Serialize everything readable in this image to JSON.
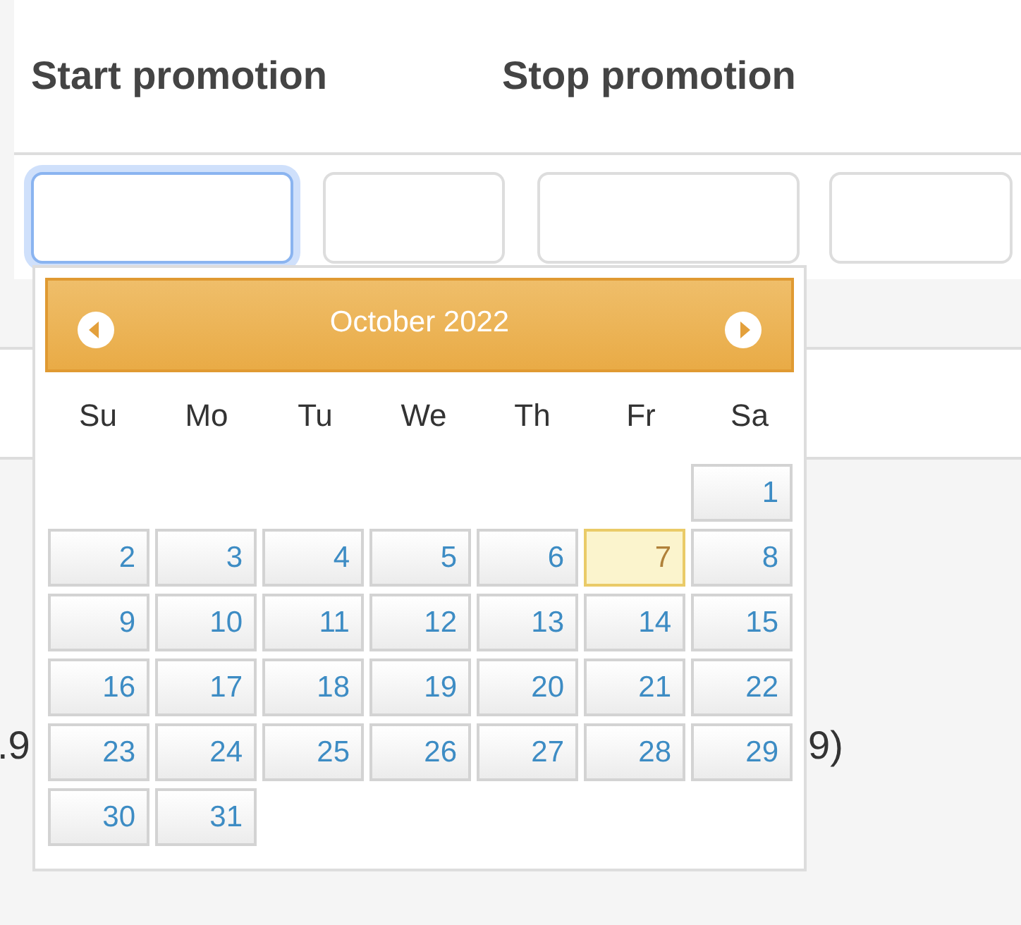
{
  "headings": [
    "Start promotion",
    "Stop promotion"
  ],
  "fields": [
    {
      "focused": true
    },
    {
      "focused": false
    },
    {
      "focused": false
    },
    {
      "focused": false
    }
  ],
  "background_texts": [
    ".9",
    "9)"
  ],
  "datepicker": {
    "title": "October 2022",
    "weekdays": [
      "Su",
      "Mo",
      "Tu",
      "We",
      "Th",
      "Fr",
      "Sa"
    ],
    "weeks": [
      [
        {
          "kind": "blank"
        },
        {
          "kind": "blank"
        },
        {
          "kind": "blank"
        },
        {
          "kind": "blank"
        },
        {
          "kind": "blank"
        },
        {
          "kind": "blank"
        },
        {
          "kind": "day",
          "label": "1",
          "today": false
        }
      ],
      [
        {
          "kind": "day",
          "label": "2",
          "today": false
        },
        {
          "kind": "day",
          "label": "3",
          "today": false
        },
        {
          "kind": "day",
          "label": "4",
          "today": false
        },
        {
          "kind": "day",
          "label": "5",
          "today": false
        },
        {
          "kind": "day",
          "label": "6",
          "today": false
        },
        {
          "kind": "day",
          "label": "7",
          "today": true
        },
        {
          "kind": "day",
          "label": "8",
          "today": false
        }
      ],
      [
        {
          "kind": "day",
          "label": "9",
          "today": false
        },
        {
          "kind": "day",
          "label": "10",
          "today": false
        },
        {
          "kind": "day",
          "label": "11",
          "today": false
        },
        {
          "kind": "day",
          "label": "12",
          "today": false
        },
        {
          "kind": "day",
          "label": "13",
          "today": false
        },
        {
          "kind": "day",
          "label": "14",
          "today": false
        },
        {
          "kind": "day",
          "label": "15",
          "today": false
        }
      ],
      [
        {
          "kind": "day",
          "label": "16",
          "today": false
        },
        {
          "kind": "day",
          "label": "17",
          "today": false
        },
        {
          "kind": "day",
          "label": "18",
          "today": false
        },
        {
          "kind": "day",
          "label": "19",
          "today": false
        },
        {
          "kind": "day",
          "label": "20",
          "today": false
        },
        {
          "kind": "day",
          "label": "21",
          "today": false
        },
        {
          "kind": "day",
          "label": "22",
          "today": false
        }
      ],
      [
        {
          "kind": "day",
          "label": "23",
          "today": false
        },
        {
          "kind": "day",
          "label": "24",
          "today": false
        },
        {
          "kind": "day",
          "label": "25",
          "today": false
        },
        {
          "kind": "day",
          "label": "26",
          "today": false
        },
        {
          "kind": "day",
          "label": "27",
          "today": false
        },
        {
          "kind": "day",
          "label": "28",
          "today": false
        },
        {
          "kind": "day",
          "label": "29",
          "today": false
        }
      ],
      [
        {
          "kind": "day",
          "label": "30",
          "today": false
        },
        {
          "kind": "day",
          "label": "31",
          "today": false
        },
        {
          "kind": "blank"
        },
        {
          "kind": "blank"
        },
        {
          "kind": "blank"
        },
        {
          "kind": "blank"
        },
        {
          "kind": "blank"
        }
      ]
    ]
  }
}
